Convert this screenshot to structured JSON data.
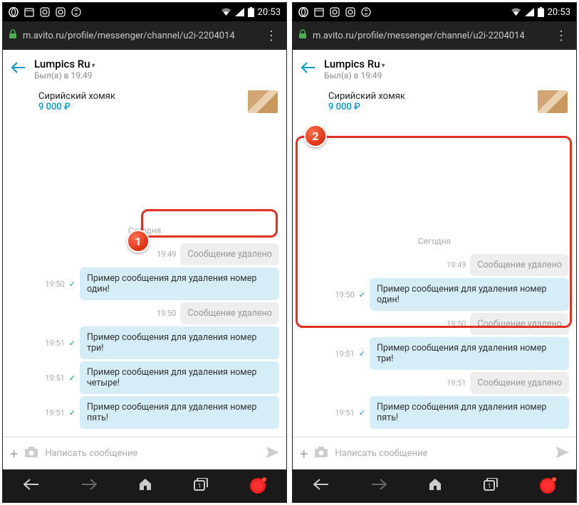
{
  "statusbar": {
    "time": "20:53"
  },
  "url": "m.avito.ru/profile/messenger/channel/u2i-2204014",
  "header": {
    "title": "Lumpics Ru",
    "subtitle": "Был(а) в 19:49"
  },
  "item": {
    "title": "Сирийский хомяк",
    "price": "9 000 ₽"
  },
  "day_label": "Сегодня",
  "deleted_text": "Сообщение удалено",
  "input_placeholder": "Написать сообщение",
  "left": {
    "messages": [
      {
        "time": "19:49",
        "deleted": true
      },
      {
        "time": "19:50",
        "tick": true,
        "text": "Пример сообщения для удаления номер один!"
      },
      {
        "time": "19:50",
        "deleted": true
      },
      {
        "time": "19:51",
        "tick": true,
        "text": "Пример сообщения для удаления номер три!"
      },
      {
        "time": "19:51",
        "tick": true,
        "text": "Пример сообщения для удаления номер четыре!"
      },
      {
        "time": "19:51",
        "tick": true,
        "text": "Пример сообщения для удаления номер пять!"
      }
    ]
  },
  "right": {
    "messages": [
      {
        "time": "19:49",
        "deleted": true
      },
      {
        "time": "19:50",
        "tick": true,
        "text": "Пример сообщения для удаления номер один!"
      },
      {
        "time": "19:50",
        "deleted": true
      },
      {
        "time": "19:51",
        "tick": true,
        "text": "Пример сообщения для удаления номер три!"
      },
      {
        "time": "19:51",
        "deleted": true
      },
      {
        "time": "19:51",
        "tick": true,
        "text": "Пример сообщения для удаления номер пять!"
      }
    ]
  },
  "badges": {
    "one": "1",
    "two": "2"
  }
}
